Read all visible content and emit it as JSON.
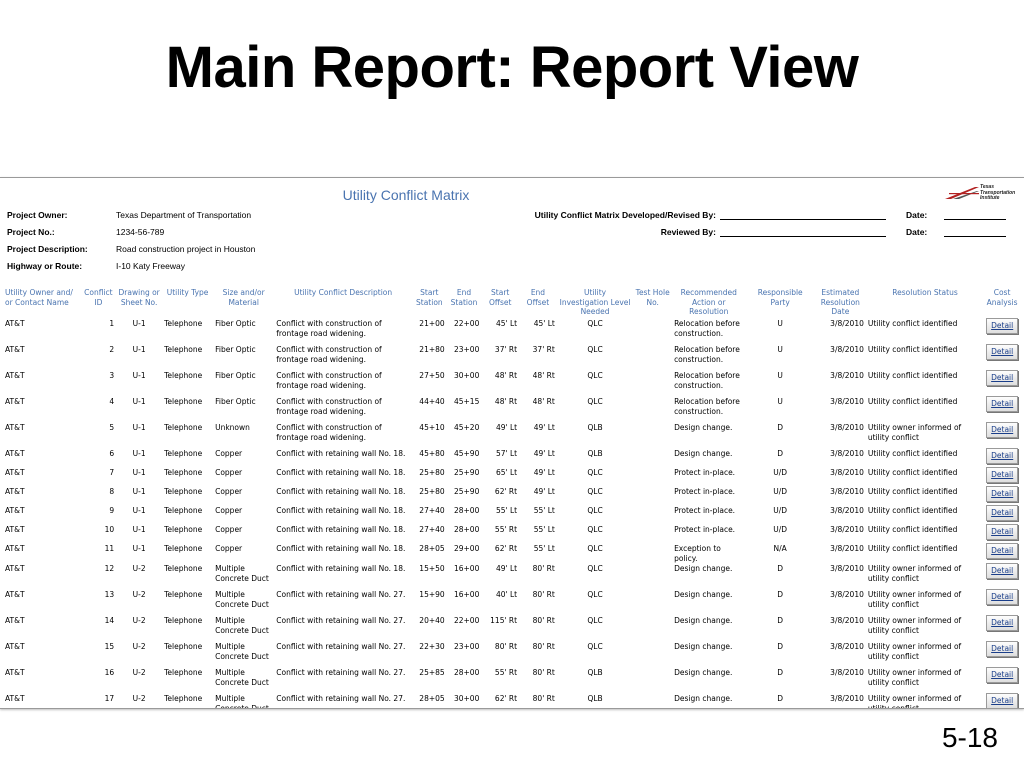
{
  "slide": {
    "title": "Main Report: Report View",
    "number": "5-18"
  },
  "report": {
    "title": "Utility Conflict Matrix",
    "logo_text": "Texas Transportation Institute",
    "meta": [
      {
        "label": "Project Owner:",
        "value": "Texas Department of Transportation"
      },
      {
        "label": "Project No.:",
        "value": "1234-56-789"
      },
      {
        "label": "Project Description:",
        "value": "Road construction project in Houston"
      },
      {
        "label": "Highway or Route:",
        "value": "I-10 Katy Freeway"
      }
    ],
    "developed_by_label": "Utility Conflict Matrix Developed/Revised By:",
    "reviewed_by_label": "Reviewed By:",
    "date_label": "Date:"
  },
  "columns": [
    "Utility Owner and/ or Contact Name",
    "Conflict ID",
    "Drawing or Sheet No.",
    "Utility Type",
    "Size and/or Material",
    "Utility Conflict Description",
    "Start Station",
    "End Station",
    "Start Offset",
    "End Offset",
    "Utility Investigation Level Needed",
    "Test Hole No.",
    "Recommended Action or Resolution",
    "Responsible Party",
    "Estimated Resolution Date",
    "Resolution Status",
    "Cost Analysis"
  ],
  "detail_label": "Detail",
  "rows": [
    [
      "AT&T",
      "1",
      "U-1",
      "Telephone",
      "Fiber Optic",
      "Conflict with construction of frontage road widening.",
      "21+00",
      "22+00",
      "45' Lt",
      "45' Lt",
      "QLC",
      "",
      "Relocation before construction.",
      "U",
      "3/8/2010",
      "Utility conflict identified"
    ],
    [
      "AT&T",
      "2",
      "U-1",
      "Telephone",
      "Fiber Optic",
      "Conflict with construction of frontage road widening.",
      "21+80",
      "23+00",
      "37' Rt",
      "37' Rt",
      "QLC",
      "",
      "Relocation before construction.",
      "U",
      "3/8/2010",
      "Utility conflict identified"
    ],
    [
      "AT&T",
      "3",
      "U-1",
      "Telephone",
      "Fiber Optic",
      "Conflict with construction of frontage road widening.",
      "27+50",
      "30+00",
      "48' Rt",
      "48' Rt",
      "QLC",
      "",
      "Relocation before construction.",
      "U",
      "3/8/2010",
      "Utility conflict identified"
    ],
    [
      "AT&T",
      "4",
      "U-1",
      "Telephone",
      "Fiber Optic",
      "Conflict with construction of frontage road widening.",
      "44+40",
      "45+15",
      "48' Rt",
      "48' Rt",
      "QLC",
      "",
      "Relocation before construction.",
      "U",
      "3/8/2010",
      "Utility conflict identified"
    ],
    [
      "AT&T",
      "5",
      "U-1",
      "Telephone",
      "Unknown",
      "Conflict with construction of frontage road widening.",
      "45+10",
      "45+20",
      "49' Lt",
      "49' Lt",
      "QLB",
      "",
      "Design change.",
      "D",
      "3/8/2010",
      "Utility owner informed of utility conflict"
    ],
    [
      "AT&T",
      "6",
      "U-1",
      "Telephone",
      "Copper",
      "Conflict with retaining wall No. 18.",
      "45+80",
      "45+90",
      "57' Lt",
      "49' Lt",
      "QLB",
      "",
      "Design change.",
      "D",
      "3/8/2010",
      "Utility conflict identified"
    ],
    [
      "AT&T",
      "7",
      "U-1",
      "Telephone",
      "Copper",
      "Conflict with retaining wall No. 18.",
      "25+80",
      "25+90",
      "65' Lt",
      "49' Lt",
      "QLC",
      "",
      "Protect in-place.",
      "U/D",
      "3/8/2010",
      "Utility conflict identified"
    ],
    [
      "AT&T",
      "8",
      "U-1",
      "Telephone",
      "Copper",
      "Conflict with retaining wall No. 18.",
      "25+80",
      "25+90",
      "62' Rt",
      "49' Lt",
      "QLC",
      "",
      "Protect in-place.",
      "U/D",
      "3/8/2010",
      "Utility conflict identified"
    ],
    [
      "AT&T",
      "9",
      "U-1",
      "Telephone",
      "Copper",
      "Conflict with retaining wall No. 18.",
      "27+40",
      "28+00",
      "55' Lt",
      "55' Lt",
      "QLC",
      "",
      "Protect in-place.",
      "U/D",
      "3/8/2010",
      "Utility conflict identified"
    ],
    [
      "AT&T",
      "10",
      "U-1",
      "Telephone",
      "Copper",
      "Conflict with retaining wall No. 18.",
      "27+40",
      "28+00",
      "55' Rt",
      "55' Lt",
      "QLC",
      "",
      "Protect in-place.",
      "U/D",
      "3/8/2010",
      "Utility conflict identified"
    ],
    [
      "AT&T",
      "11",
      "U-1",
      "Telephone",
      "Copper",
      "Conflict with retaining wall No. 18.",
      "28+05",
      "29+00",
      "62' Rt",
      "55' Lt",
      "QLC",
      "",
      "Exception to policy.",
      "N/A",
      "3/8/2010",
      "Utility conflict identified"
    ],
    [
      "AT&T",
      "12",
      "U-2",
      "Telephone",
      "Multiple Concrete Duct",
      "Conflict with retaining wall No. 18.",
      "15+50",
      "16+00",
      "49' Lt",
      "80' Rt",
      "QLC",
      "",
      "Design change.",
      "D",
      "3/8/2010",
      "Utility owner informed of utility conflict"
    ],
    [
      "AT&T",
      "13",
      "U-2",
      "Telephone",
      "Multiple Concrete Duct",
      "Conflict with retaining wall No. 27.",
      "15+90",
      "16+00",
      "40' Lt",
      "80' Rt",
      "QLC",
      "",
      "Design change.",
      "D",
      "3/8/2010",
      "Utility owner informed of utility conflict"
    ],
    [
      "AT&T",
      "14",
      "U-2",
      "Telephone",
      "Multiple Concrete Duct",
      "Conflict with retaining wall No. 27.",
      "20+40",
      "22+00",
      "115' Rt",
      "80' Rt",
      "QLC",
      "",
      "Design change.",
      "D",
      "3/8/2010",
      "Utility owner informed of utility conflict"
    ],
    [
      "AT&T",
      "15",
      "U-2",
      "Telephone",
      "Multiple Concrete Duct",
      "Conflict with retaining wall No. 27.",
      "22+30",
      "23+00",
      "80' Rt",
      "80' Rt",
      "QLC",
      "",
      "Design change.",
      "D",
      "3/8/2010",
      "Utility owner informed of utility conflict"
    ],
    [
      "AT&T",
      "16",
      "U-2",
      "Telephone",
      "Multiple Concrete Duct",
      "Conflict with retaining wall No. 27.",
      "25+85",
      "28+00",
      "55' Rt",
      "80' Rt",
      "QLB",
      "",
      "Design change.",
      "D",
      "3/8/2010",
      "Utility owner informed of utility conflict"
    ],
    [
      "AT&T",
      "17",
      "U-2",
      "Telephone",
      "Multiple Concrete Duct",
      "Conflict with retaining wall No. 27.",
      "28+05",
      "30+00",
      "62' Rt",
      "80' Rt",
      "QLB",
      "",
      "Design change.",
      "D",
      "3/8/2010",
      "Utility owner informed of utility conflict"
    ]
  ],
  "colors": {
    "accent": "#4a74b0",
    "logo_red": "#b22222"
  }
}
